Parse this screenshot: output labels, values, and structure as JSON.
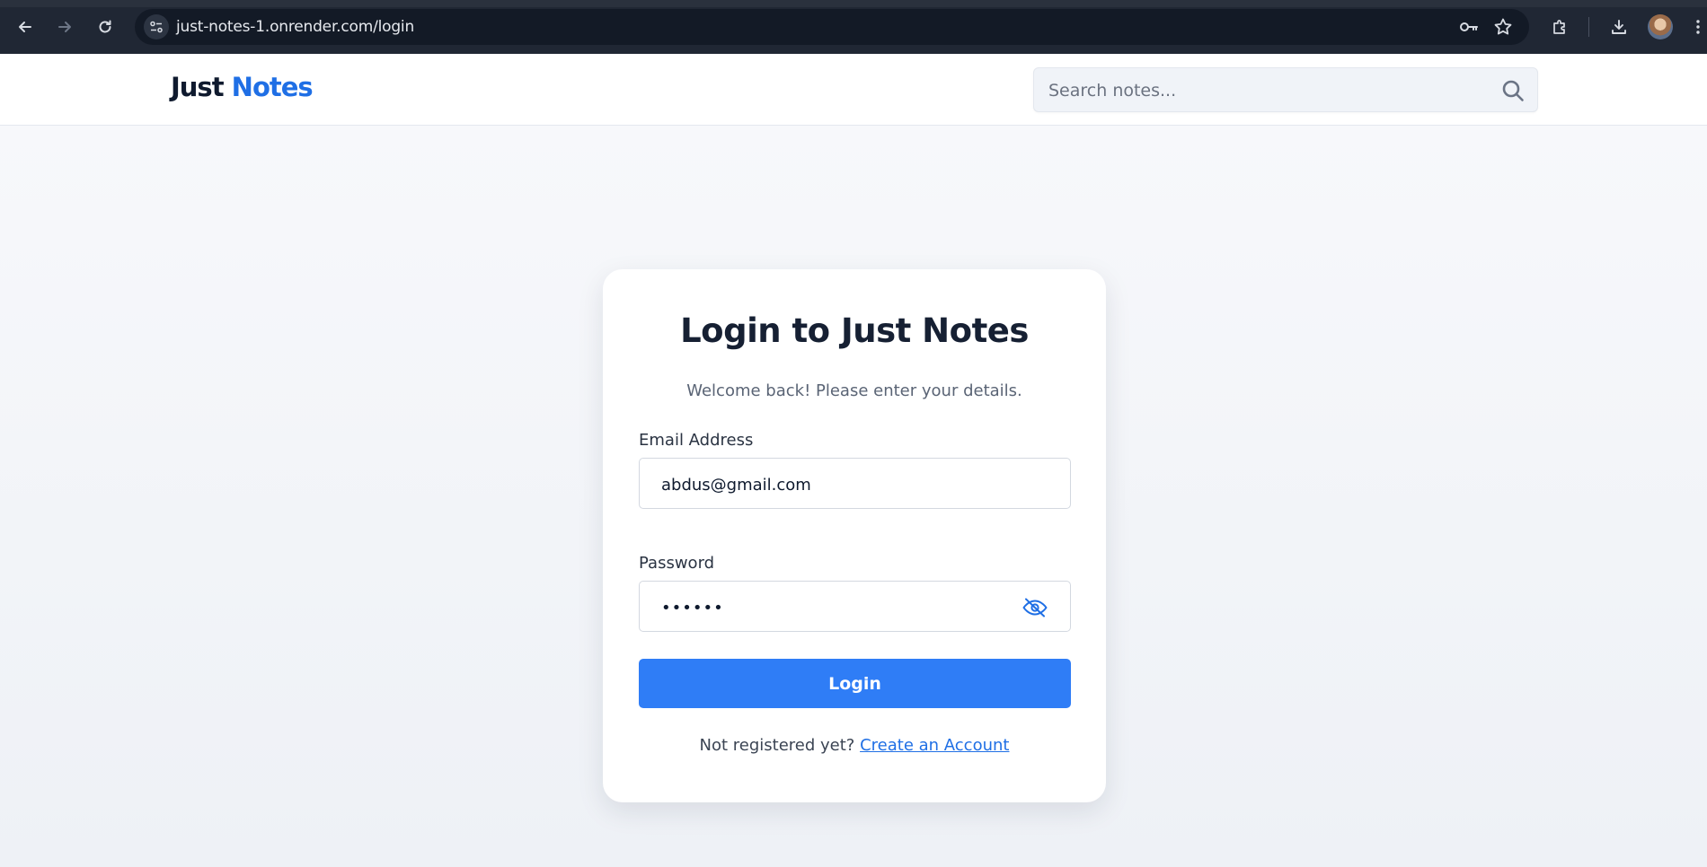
{
  "browser": {
    "url": "just-notes-1.onrender.com/login",
    "icons": [
      "back-icon",
      "forward-icon",
      "reload-icon",
      "site-info-icon",
      "key-icon",
      "star-icon",
      "extensions-icon",
      "download-icon",
      "profile-avatar",
      "more-icon"
    ]
  },
  "header": {
    "logo_part1": "Just",
    "logo_part2": "Notes",
    "search_placeholder": "Search notes..."
  },
  "login": {
    "title": "Login to Just Notes",
    "subtitle": "Welcome back! Please enter your details.",
    "email_label": "Email Address",
    "email_value": "abdus@gmail.com",
    "password_label": "Password",
    "password_value": "••••••",
    "button_label": "Login",
    "register_prompt": "Not registered yet?",
    "register_link": "Create an Account"
  },
  "colors": {
    "brand_blue": "#1f6fe5",
    "button_blue": "#2f7df6",
    "heading_dark": "#162033"
  }
}
